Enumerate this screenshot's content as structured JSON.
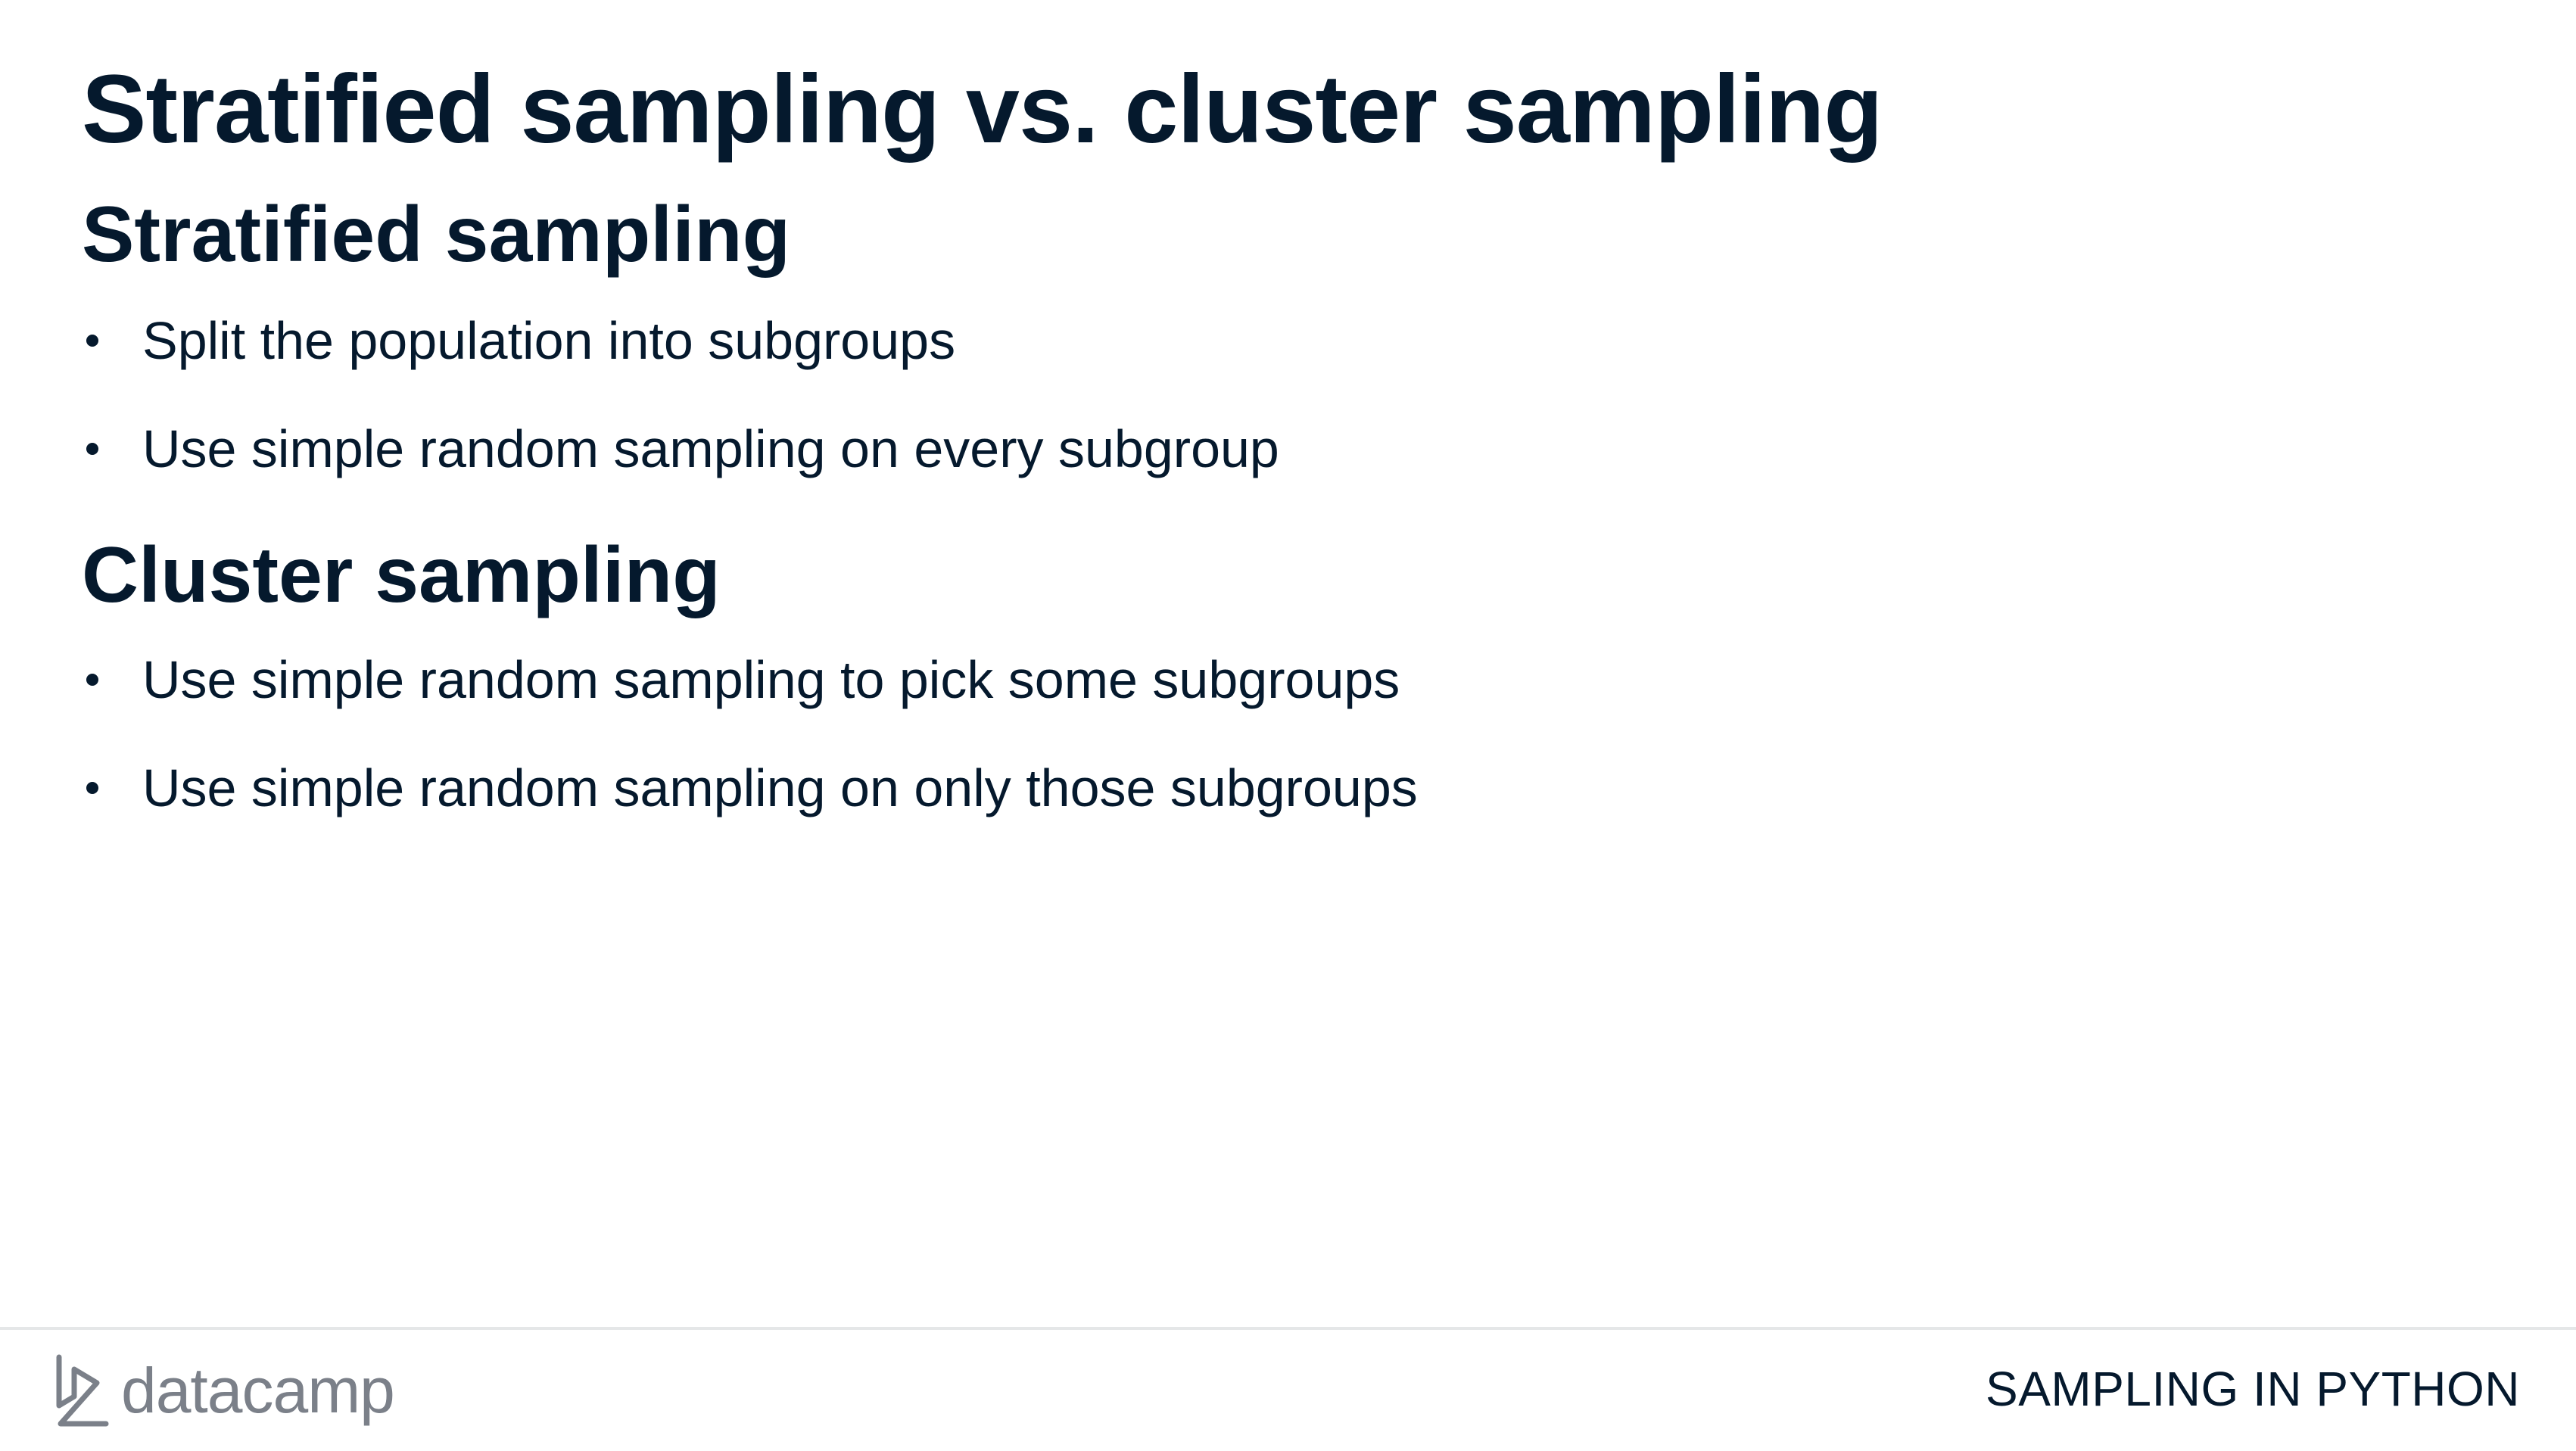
{
  "slide": {
    "title": "Stratified sampling vs. cluster sampling",
    "sections": [
      {
        "heading": "Stratified sampling",
        "bullets": [
          "Split the population into subgroups",
          "Use simple random sampling on every subgroup"
        ]
      },
      {
        "heading": "Cluster sampling",
        "bullets": [
          "Use simple random sampling to pick some subgroups",
          "Use simple random sampling on only those subgroups"
        ]
      }
    ]
  },
  "footer": {
    "logo_text": "datacamp",
    "logo_icon": "datacamp-logo-icon",
    "course_label": "SAMPLING IN PYTHON"
  },
  "colors": {
    "text": "#05192d",
    "logo": "#7b8089",
    "divider": "#e5e7e8",
    "background": "#ffffff"
  }
}
